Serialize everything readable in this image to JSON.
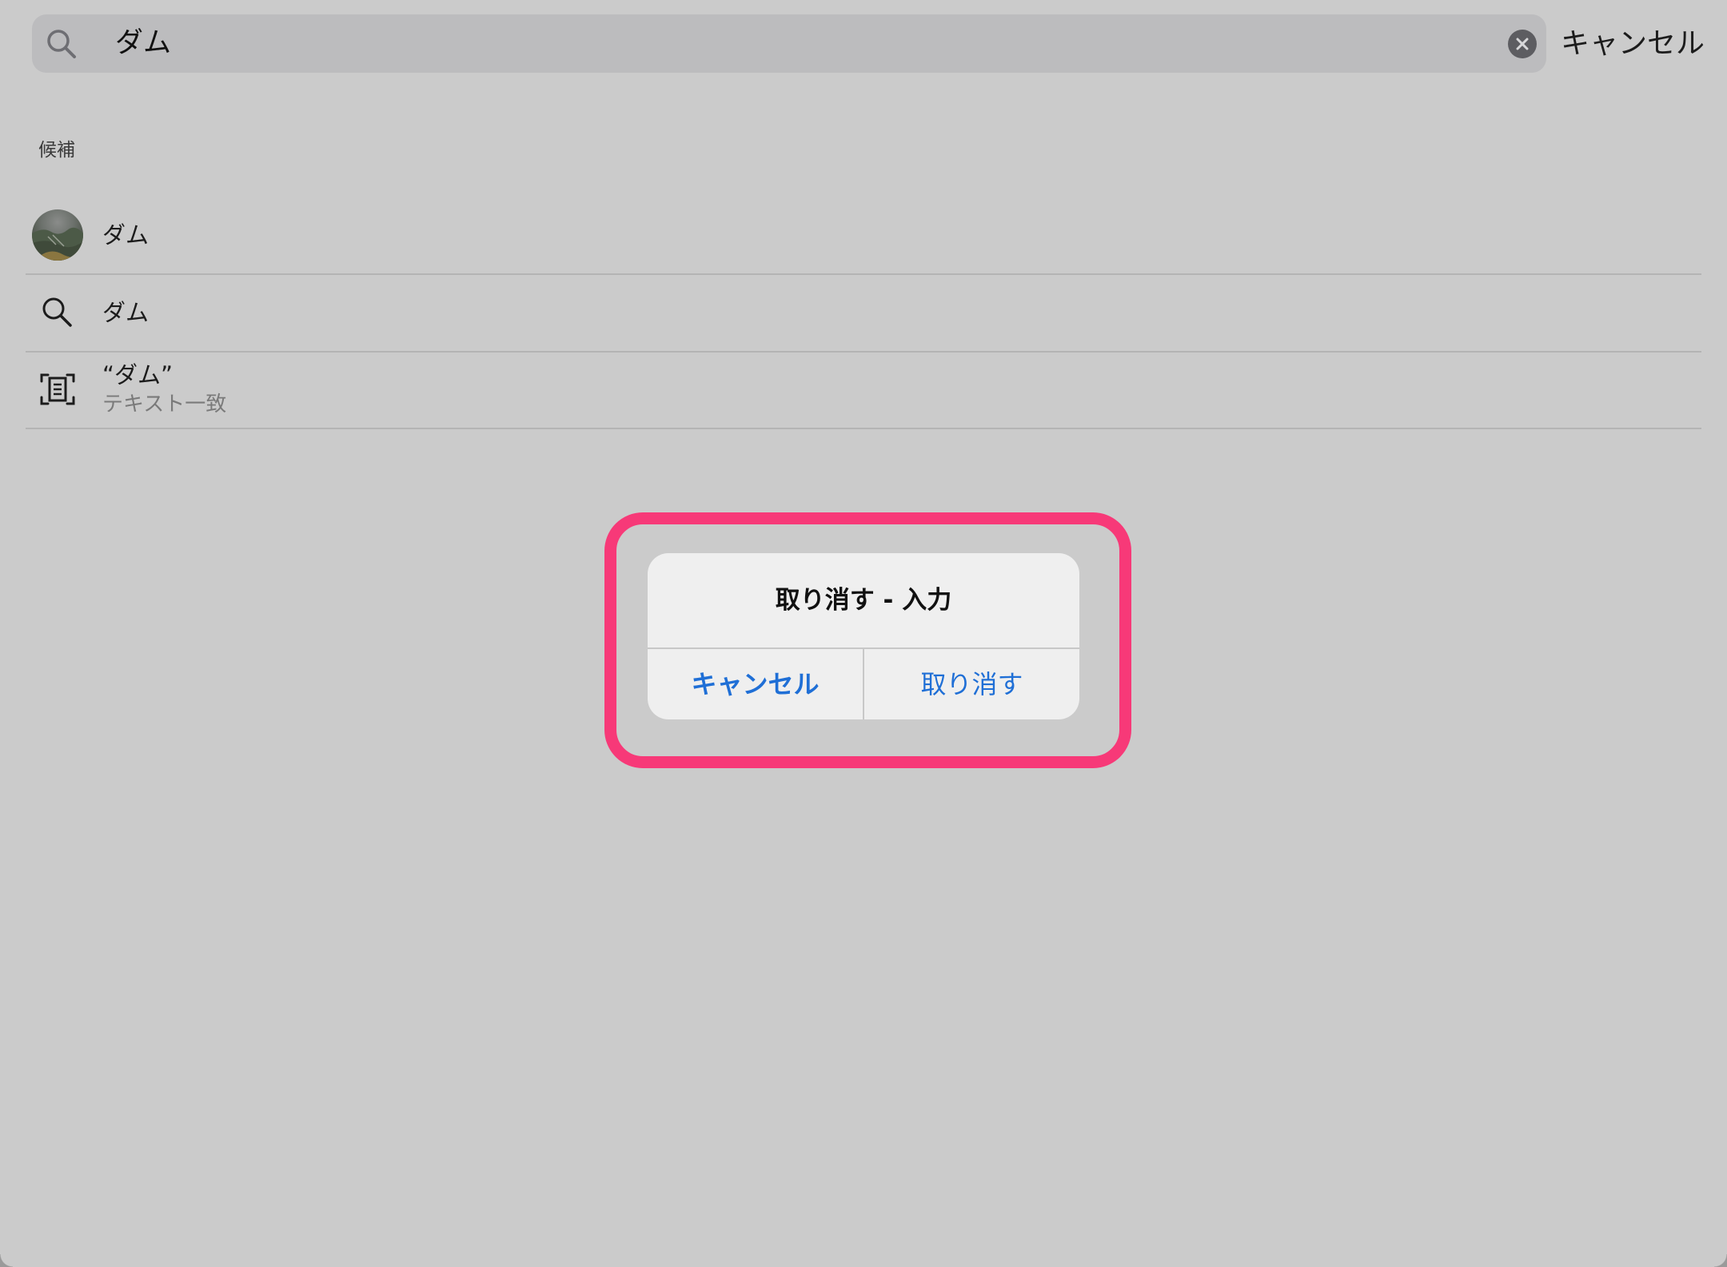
{
  "search": {
    "value": "ダム",
    "icon": "search-icon",
    "clear_icon": "clear-circle-icon"
  },
  "header": {
    "cancel_label": "キャンセル"
  },
  "suggestions": {
    "section_title": "候補",
    "items": [
      {
        "label": "ダム",
        "icon": "photo-thumbnail"
      },
      {
        "label": "ダム",
        "icon": "search-icon"
      },
      {
        "label": "“ダム”",
        "sublabel": "テキスト一致",
        "icon": "text-scan-icon"
      }
    ]
  },
  "alert": {
    "title": "取り消す - 入力",
    "cancel_label": "キャンセル",
    "undo_label": "取り消す",
    "highlight_color": "#f73978",
    "button_color": "#1f6fd6"
  }
}
